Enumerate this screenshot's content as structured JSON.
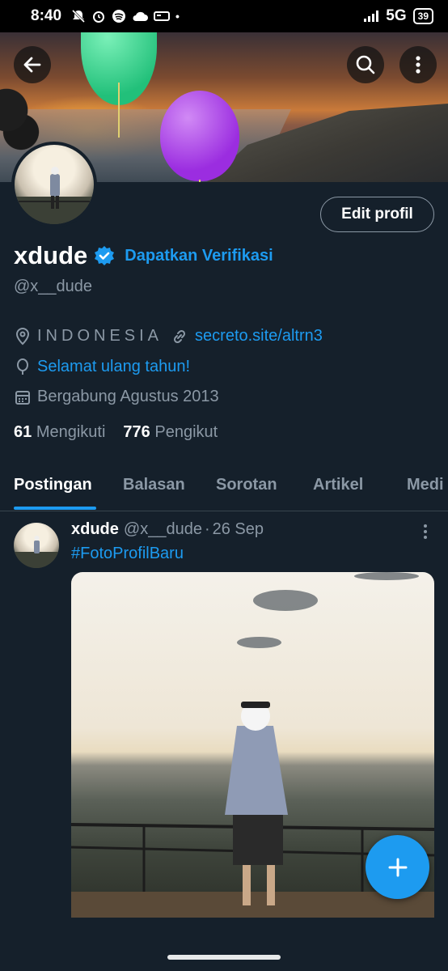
{
  "status_bar": {
    "time": "8:40",
    "network": "5G",
    "battery": "39"
  },
  "profile": {
    "name": "xdude",
    "verify_link": "Dapatkan Verifikasi",
    "handle": "@x__dude",
    "edit_label": "Edit profil",
    "location": "INDONESIA",
    "website": "secreto.site/altrn3",
    "birthday": "Selamat ulang tahun!",
    "joined": "Bergabung Agustus 2013",
    "following_count": "61",
    "following_label": "Mengikuti",
    "followers_count": "776",
    "followers_label": "Pengikut"
  },
  "tabs": [
    {
      "label": "Postingan",
      "active": true
    },
    {
      "label": "Balasan",
      "active": false
    },
    {
      "label": "Sorotan",
      "active": false
    },
    {
      "label": "Artikel",
      "active": false
    },
    {
      "label": "Medi",
      "active": false
    }
  ],
  "post": {
    "author": "xdude",
    "handle": "@x__dude",
    "separator": "·",
    "date": "26 Sep",
    "hashtag": "#FotoProfilBaru"
  },
  "colors": {
    "accent": "#1d9bf0",
    "background": "#15202b",
    "muted": "#8b98a5"
  },
  "icons": [
    "back-arrow-icon",
    "search-icon",
    "more-vertical-icon",
    "verified-badge-icon",
    "location-pin-icon",
    "link-icon",
    "balloon-icon",
    "calendar-icon",
    "plus-icon"
  ]
}
